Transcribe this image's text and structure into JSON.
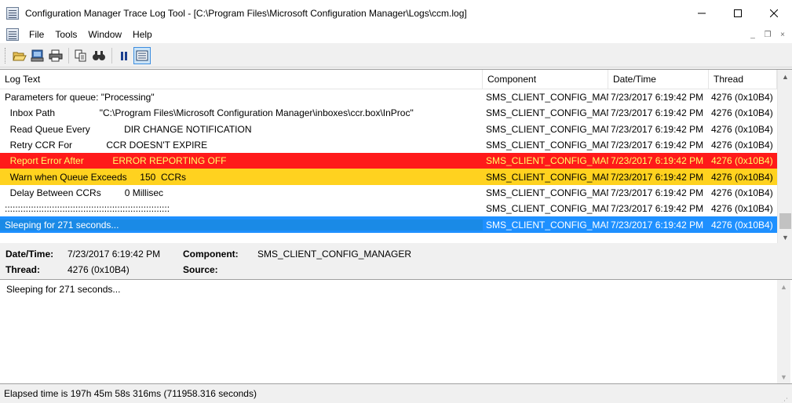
{
  "window": {
    "title": "Configuration Manager Trace Log Tool - [C:\\Program Files\\Microsoft Configuration Manager\\Logs\\ccm.log]",
    "minimize_icon": "minimize-icon",
    "maximize_icon": "maximize-icon",
    "close_icon": "close-icon"
  },
  "menubar": {
    "items": [
      "File",
      "Tools",
      "Window",
      "Help"
    ],
    "mdi_minimize": "_",
    "mdi_restore": "❐",
    "mdi_close": "×"
  },
  "toolbar": {
    "buttons": [
      "open-icon",
      "print-preview-icon",
      "print-icon",
      "copy-icon",
      "find-icon",
      "pause-icon",
      "highlight-icon"
    ]
  },
  "log": {
    "columns": [
      "Log Text",
      "Component",
      "Date/Time",
      "Thread"
    ],
    "rows": [
      {
        "text": "Parameters for queue: \"Processing\"",
        "component": "SMS_CLIENT_CONFIG_MANAGER",
        "datetime": "7/23/2017 6:19:42 PM",
        "thread": "4276 (0x10B4)",
        "style": "normal"
      },
      {
        "text": "  Inbox Path                 \"C:\\Program Files\\Microsoft Configuration Manager\\inboxes\\ccr.box\\InProc\"",
        "component": "SMS_CLIENT_CONFIG_MANAGER",
        "datetime": "7/23/2017 6:19:42 PM",
        "thread": "4276 (0x10B4)",
        "style": "normal"
      },
      {
        "text": "  Read Queue Every             DIR CHANGE NOTIFICATION",
        "component": "SMS_CLIENT_CONFIG_MANAGER",
        "datetime": "7/23/2017 6:19:42 PM",
        "thread": "4276 (0x10B4)",
        "style": "normal"
      },
      {
        "text": "  Retry CCR For             CCR DOESN'T EXPIRE",
        "component": "SMS_CLIENT_CONFIG_MANAGER",
        "datetime": "7/23/2017 6:19:42 PM",
        "thread": "4276 (0x10B4)",
        "style": "normal"
      },
      {
        "text": "  Report Error After           ERROR REPORTING OFF",
        "component": "SMS_CLIENT_CONFIG_MANAGER",
        "datetime": "7/23/2017 6:19:42 PM",
        "thread": "4276 (0x10B4)",
        "style": "error"
      },
      {
        "text": "  Warn when Queue Exceeds     150  CCRs",
        "component": "SMS_CLIENT_CONFIG_MANAGER",
        "datetime": "7/23/2017 6:19:42 PM",
        "thread": "4276 (0x10B4)",
        "style": "warn"
      },
      {
        "text": "  Delay Between CCRs         0 Millisec",
        "component": "SMS_CLIENT_CONFIG_MANAGER",
        "datetime": "7/23/2017 6:19:42 PM",
        "thread": "4276 (0x10B4)",
        "style": "normal"
      },
      {
        "text": ":::::::::::::::::::::::::::::::::::::::::::::::::::::::::::::::",
        "component": "SMS_CLIENT_CONFIG_MANAGER",
        "datetime": "7/23/2017 6:19:42 PM",
        "thread": "4276 (0x10B4)",
        "style": "normal"
      },
      {
        "text": "Sleeping for 271 seconds...",
        "component": "SMS_CLIENT_CONFIG_MANAGER",
        "datetime": "7/23/2017 6:19:42 PM",
        "thread": "4276 (0x10B4)",
        "style": "selected"
      }
    ]
  },
  "details": {
    "datetime_label": "Date/Time:",
    "datetime_value": "7/23/2017 6:19:42 PM",
    "component_label": "Component:",
    "component_value": "SMS_CLIENT_CONFIG_MANAGER",
    "thread_label": "Thread:",
    "thread_value": "4276 (0x10B4)",
    "source_label": "Source:",
    "source_value": ""
  },
  "message": {
    "text": "Sleeping for 271 seconds..."
  },
  "status": {
    "text": "Elapsed time is 197h 45m 58s 316ms (711958.316 seconds)"
  },
  "colors": {
    "error_row": "#ff1a1a",
    "error_text": "#ffff66",
    "warn_row": "#ffd21f",
    "selected_row": "#1e90ff"
  }
}
